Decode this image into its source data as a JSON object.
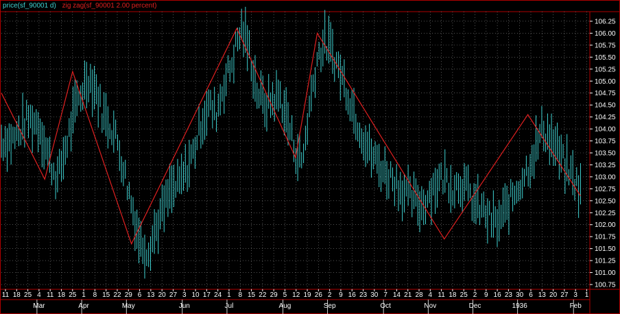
{
  "legend": {
    "price": "price(sf_90001 d)",
    "zigzag": "zig zag(sf_90001 2.00 percent)"
  },
  "colors": {
    "background": "#000000",
    "price_bars": "#3fd3d3",
    "zigzag": "#e02020",
    "grid": "#8a8a8a",
    "frame": "#b00000",
    "text": "#ffffff"
  },
  "chart_data": {
    "type": "line",
    "grid": "dotted",
    "legend_placement": "top-left",
    "ylim": [
      100.65,
      106.45
    ],
    "y_ticks": [
      "106.25",
      "106.00",
      "105.75",
      "105.50",
      "105.25",
      "105.00",
      "104.75",
      "104.50",
      "104.25",
      "104.00",
      "103.75",
      "103.50",
      "103.25",
      "103.00",
      "102.75",
      "102.50",
      "102.25",
      "102.00",
      "101.75",
      "101.50",
      "101.25",
      "101.00",
      "100.75"
    ],
    "x_day_ticks": [
      "11",
      "18",
      "25",
      "4",
      "11",
      "18",
      "25",
      "1",
      "8",
      "15",
      "22",
      "29",
      "6",
      "13",
      "20",
      "27",
      "3",
      "10",
      "17",
      "24",
      "1",
      "8",
      "15",
      "22",
      "29",
      "5",
      "12",
      "19",
      "26",
      "2",
      "9",
      "16",
      "23",
      "30",
      "7",
      "14",
      "21",
      "28",
      "4",
      "11",
      "18",
      "25",
      "2",
      "9",
      "16",
      "23",
      "30",
      "6",
      "13",
      "20",
      "27",
      "3",
      "1"
    ],
    "x_month_labels": [
      "Mar",
      "Apr",
      "May",
      "Jun",
      "Jul",
      "Aug",
      "Sep",
      "Oct",
      "Nov",
      "Dec",
      "1936",
      "Feb"
    ],
    "x_range_bars": [
      0,
      120
    ],
    "series": [
      {
        "kind": "price",
        "points": [
          [
            0,
            103.75
          ],
          [
            3.5,
            103.8
          ],
          [
            7,
            104.2
          ],
          [
            10,
            104.1
          ],
          [
            13,
            103.3
          ],
          [
            15,
            102.95
          ],
          [
            18,
            103.9
          ],
          [
            20,
            104.5
          ],
          [
            23,
            105.1
          ],
          [
            25,
            104.85
          ],
          [
            27,
            104.3
          ],
          [
            29,
            104.1
          ],
          [
            31,
            103.7
          ],
          [
            33,
            103.0
          ],
          [
            35,
            102.3
          ],
          [
            37,
            101.6
          ],
          [
            39,
            101.5
          ],
          [
            41,
            101.9
          ],
          [
            43,
            102.3
          ],
          [
            45,
            102.7
          ],
          [
            47,
            102.8
          ],
          [
            49,
            103.1
          ],
          [
            51,
            103.5
          ],
          [
            53,
            104.1
          ],
          [
            55,
            104.5
          ],
          [
            57,
            104.3
          ],
          [
            59,
            104.9
          ],
          [
            61,
            105.3
          ],
          [
            63,
            105.9
          ],
          [
            64,
            106.1
          ],
          [
            66,
            105.6
          ],
          [
            68,
            104.8
          ],
          [
            70,
            104.5
          ],
          [
            72,
            104.6
          ],
          [
            74,
            104.7
          ],
          [
            76,
            104.2
          ],
          [
            78,
            103.6
          ],
          [
            80,
            103.3
          ],
          [
            82,
            104.5
          ],
          [
            84,
            105.5
          ],
          [
            86,
            105.8
          ],
          [
            88,
            105.6
          ],
          [
            90,
            105.2
          ],
          [
            92,
            104.8
          ],
          [
            94,
            104.3
          ],
          [
            96,
            103.9
          ],
          [
            98,
            103.5
          ],
          [
            100,
            103.3
          ],
          [
            102,
            103.1
          ],
          [
            104,
            103.0
          ],
          [
            106,
            102.8
          ],
          [
            108,
            102.6
          ],
          [
            110,
            102.5
          ],
          [
            112,
            102.4
          ],
          [
            114,
            102.7
          ],
          [
            116,
            102.9
          ],
          [
            118,
            103.0
          ],
          [
            120,
            102.8
          ],
          [
            122,
            102.9
          ],
          [
            124,
            102.7
          ],
          [
            126,
            102.4
          ],
          [
            128,
            102.3
          ],
          [
            130,
            102.1
          ],
          [
            132,
            102.0
          ],
          [
            134,
            102.3
          ],
          [
            136,
            102.6
          ],
          [
            138,
            102.9
          ],
          [
            140,
            103.2
          ],
          [
            142,
            103.6
          ],
          [
            144,
            104.0
          ],
          [
            146,
            103.8
          ],
          [
            148,
            103.5
          ],
          [
            150,
            103.2
          ],
          [
            152,
            103.0
          ],
          [
            154,
            102.7
          ]
        ]
      },
      {
        "kind": "zigzag",
        "points": [
          [
            0,
            104.75
          ],
          [
            14,
            102.95
          ],
          [
            23,
            105.2
          ],
          [
            42,
            101.6
          ],
          [
            76,
            106.1
          ],
          [
            95,
            103.4
          ],
          [
            102,
            106.0
          ],
          [
            143,
            101.7
          ],
          [
            170,
            104.3
          ],
          [
            187,
            102.6
          ]
        ]
      }
    ]
  }
}
